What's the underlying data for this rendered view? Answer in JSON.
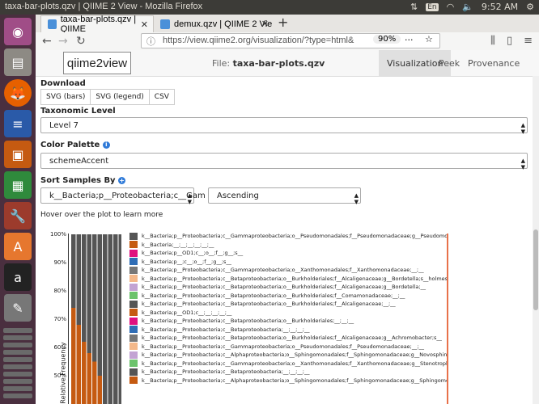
{
  "os": {
    "window_title": "taxa-bar-plots.qzv | QIIME 2 View - Mozilla Firefox",
    "keyboard": "En",
    "time": "9:52 AM"
  },
  "browser": {
    "tabs": [
      {
        "label": "taxa-bar-plots.qzv | QIIME",
        "active": true
      },
      {
        "label": "demux.qzv | QIIME 2 Vie",
        "active": false
      }
    ],
    "url": "https://view.qiime2.org/visualization/?type=html&",
    "zoom": "90%"
  },
  "app": {
    "logo": "qiime2view",
    "file_label": "File:",
    "file_name": "taxa-bar-plots.qzv",
    "tabs": [
      "Visualization",
      "Peek",
      "Provenance"
    ]
  },
  "controls": {
    "download_label": "Download",
    "download_buttons": [
      "SVG (bars)",
      "SVG (legend)",
      "CSV"
    ],
    "taxonomic_level_label": "Taxonomic Level",
    "taxonomic_level_value": "Level 7",
    "color_palette_label": "Color Palette",
    "color_palette_value": "schemeAccent",
    "sort_label": "Sort Samples By",
    "sort_by_value": "k__Bacteria;p__Proteobacteria;c__Gam",
    "sort_order_value": "Ascending",
    "hint": "Hover over the plot to learn more"
  },
  "chart_data": {
    "type": "bar",
    "ylabel": "Relative Frequency",
    "yticks": [
      "100%",
      "90%",
      "80%",
      "70%",
      "60%",
      "50%"
    ],
    "ylim": [
      50,
      100
    ],
    "bars": [
      {
        "segments": [
          {
            "color": "#555555",
            "top": 100
          },
          {
            "color": "#c55a11",
            "top": 74
          }
        ]
      },
      {
        "segments": [
          {
            "color": "#555555",
            "top": 100
          },
          {
            "color": "#c55a11",
            "top": 68
          }
        ]
      },
      {
        "segments": [
          {
            "color": "#555555",
            "top": 100
          },
          {
            "color": "#c55a11",
            "top": 62
          }
        ]
      },
      {
        "segments": [
          {
            "color": "#555555",
            "top": 100
          },
          {
            "color": "#c55a11",
            "top": 58
          }
        ]
      },
      {
        "segments": [
          {
            "color": "#555555",
            "top": 100
          },
          {
            "color": "#c55a11",
            "top": 55
          }
        ]
      },
      {
        "segments": [
          {
            "color": "#555555",
            "top": 100
          },
          {
            "color": "#c55a11",
            "top": 50
          }
        ]
      },
      {
        "segments": [
          {
            "color": "#555555",
            "top": 100
          }
        ]
      },
      {
        "segments": [
          {
            "color": "#555555",
            "top": 100
          }
        ]
      },
      {
        "segments": [
          {
            "color": "#555555",
            "top": 100
          }
        ]
      },
      {
        "segments": [
          {
            "color": "#555555",
            "top": 100
          }
        ]
      }
    ],
    "legend": [
      {
        "color": "#555555",
        "label": "k__Bacteria;p__Proteobacteria;c__Gammaproteobacteria;o__Pseudomonadales;f__Pseudomonadaceae;g__Pseudomonas"
      },
      {
        "color": "#c55a11",
        "label": "k__Bacteria;__;__;__;__;__;__"
      },
      {
        "color": "#e0117f",
        "label": "k__Bacteria;p__OD1;c__;o__;f__;g__;s__"
      },
      {
        "color": "#2f6db5",
        "label": "k__Bacteria;p__;c__;o__;f__;g__;s__"
      },
      {
        "color": "#777777",
        "label": "k__Bacteria;p__Proteobacteria;c__Gammaproteobacteria;o__Xanthomonadales;f__Xanthomonadaceae;__;__"
      },
      {
        "color": "#f4b88a",
        "label": "k__Bacteria;p__Proteobacteria;c__Betaproteobacteria;o__Burkholderiales;f__Alcaligenaceae;g__Bordetella;s__holmesii"
      },
      {
        "color": "#c3a3d3",
        "label": "k__Bacteria;p__Proteobacteria;c__Betaproteobacteria;o__Burkholderiales;f__Alcaligenaceae;g__Bordetella;__"
      },
      {
        "color": "#6cc36c",
        "label": "k__Bacteria;p__Proteobacteria;c__Betaproteobacteria;o__Burkholderiales;f__Comamonadaceae;__;__"
      },
      {
        "color": "#555555",
        "label": "k__Bacteria;p__Proteobacteria;c__Betaproteobacteria;o__Burkholderiales;f__Alcaligenaceae;__;__"
      },
      {
        "color": "#c55a11",
        "label": "k__Bacteria;p__OD1;c__;__;__;__;__"
      },
      {
        "color": "#e0117f",
        "label": "k__Bacteria;p__Proteobacteria;c__Betaproteobacteria;o__Burkholderiales;__;__;__"
      },
      {
        "color": "#2f6db5",
        "label": "k__Bacteria;p__Proteobacteria;c__Betaproteobacteria;__;__;__;__"
      },
      {
        "color": "#777777",
        "label": "k__Bacteria;p__Proteobacteria;c__Betaproteobacteria;o__Burkholderiales;f__Alcaligenaceae;g__Achromobacter;s__"
      },
      {
        "color": "#f4b88a",
        "label": "k__Bacteria;p__Proteobacteria;c__Gammaproteobacteria;o__Pseudomonadales;f__Pseudomonadaceae;__;__"
      },
      {
        "color": "#c3a3d3",
        "label": "k__Bacteria;p__Proteobacteria;c__Alphaproteobacteria;o__Sphingomonadales;f__Sphingomonadaceae;g__Novosphingobium"
      },
      {
        "color": "#6cc36c",
        "label": "k__Bacteria;p__Proteobacteria;c__Gammaproteobacteria;o__Xanthomonadales;f__Xanthomonadaceae;g__Stenotrophomonas"
      },
      {
        "color": "#555555",
        "label": "k__Bacteria;p__Proteobacteria;c__Betaproteobacteria;__;__;__;__"
      },
      {
        "color": "#c55a11",
        "label": "k__Bacteria;p__Proteobacteria;c__Alphaproteobacteria;o__Sphingomonadales;f__Sphingomonadaceae;g__Sphingomonas"
      }
    ]
  }
}
